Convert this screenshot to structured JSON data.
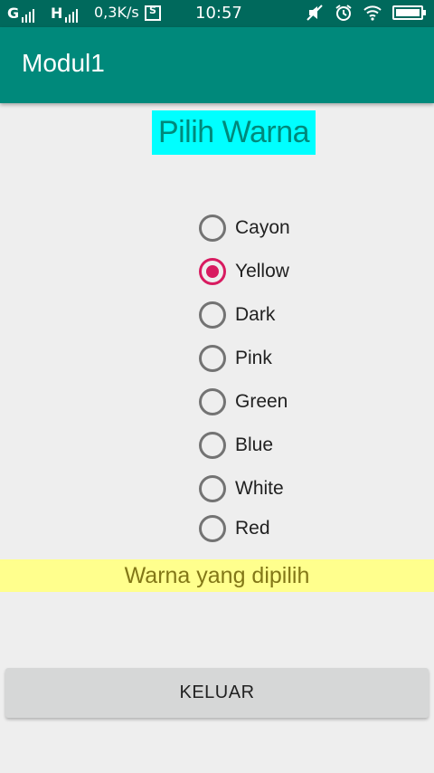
{
  "status_bar": {
    "carrier1": "G",
    "carrier2": "H",
    "speed": "0,3K/s",
    "time": "10:57",
    "icons": [
      "muted-icon",
      "alarm-icon",
      "wifi-icon",
      "battery-icon"
    ]
  },
  "app_bar": {
    "title": "Modul1",
    "color": "#00897b"
  },
  "heading": {
    "text": "Pilih Warna",
    "background": "#00ffff"
  },
  "radio_group": {
    "selected": "Yellow",
    "options": [
      {
        "label": "Cayon",
        "checked": false
      },
      {
        "label": "Yellow",
        "checked": true
      },
      {
        "label": "Dark",
        "checked": false
      },
      {
        "label": "Pink",
        "checked": false
      },
      {
        "label": "Green",
        "checked": false
      },
      {
        "label": "Blue",
        "checked": false
      },
      {
        "label": "White",
        "checked": false
      },
      {
        "label": "Red",
        "checked": false
      }
    ],
    "accent": "#d81b60"
  },
  "result": {
    "text": "Warna yang dipilih",
    "background": "#ffff8d"
  },
  "exit_button": {
    "label": "KELUAR"
  }
}
